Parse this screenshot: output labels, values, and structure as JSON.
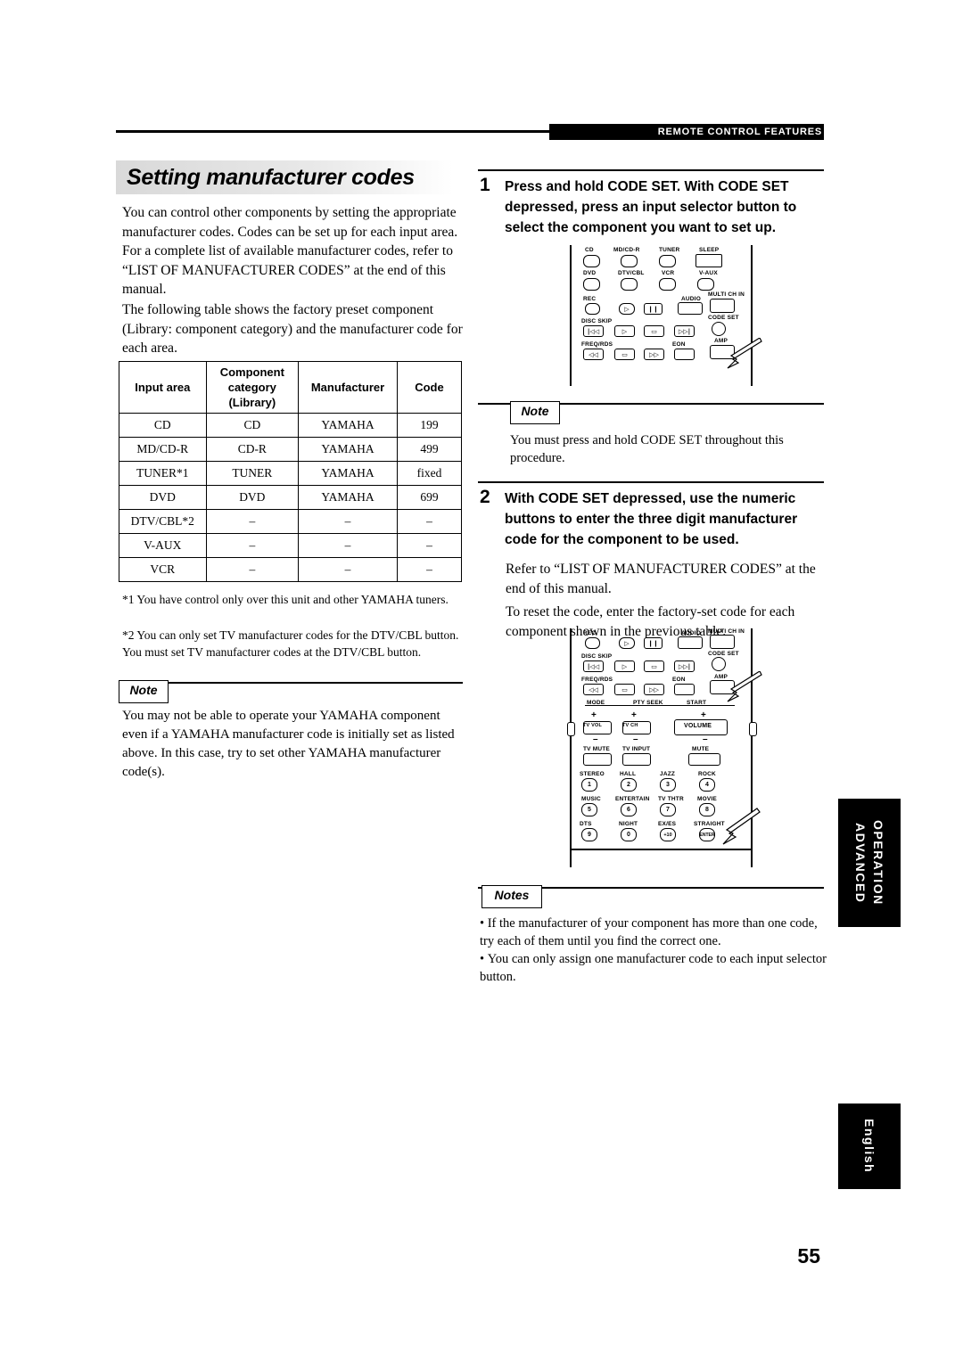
{
  "header": {
    "running_title": "REMOTE CONTROL FEATURES"
  },
  "page_number": "55",
  "left": {
    "title": "Setting manufacturer codes",
    "para1": "You can control other components by setting the appropriate manufacturer codes. Codes can be set up for each input area. For a complete list of available manufacturer codes, refer to “LIST OF MANUFACTURER CODES” at the end of this manual.",
    "para2": "The following table shows the factory preset component (Library: component category) and the manufacturer code for each area.",
    "table": {
      "headers": [
        "Input area",
        "Component category (Library)",
        "Manufacturer",
        "Code"
      ],
      "header_lines": {
        "h1": "Input area",
        "h2a": "Component",
        "h2b": "category",
        "h2c": "(Library)",
        "h3": "Manufacturer",
        "h4": "Code"
      },
      "rows": [
        [
          "CD",
          "CD",
          "YAMAHA",
          "199"
        ],
        [
          "MD/CD-R",
          "CD-R",
          "YAMAHA",
          "499"
        ],
        [
          "TUNER*1",
          "TUNER",
          "YAMAHA",
          "fixed"
        ],
        [
          "DVD",
          "DVD",
          "YAMAHA",
          "699"
        ],
        [
          "DTV/CBL*2",
          "–",
          "–",
          "–"
        ],
        [
          "V-AUX",
          "–",
          "–",
          "–"
        ],
        [
          "VCR",
          "–",
          "–",
          "–"
        ]
      ]
    },
    "footnote1": "*1 You have control only over this unit and other YAMAHA tuners.",
    "footnote2": "*2 You can only set TV manufacturer codes for the DTV/CBL button. You must set TV manufacturer codes at the DTV/CBL button.",
    "note_label": "Note",
    "note_text": "You may not be able to operate your YAMAHA component even if a YAMAHA manufacturer code is initially set as listed above. In this case, try to set other YAMAHA manufacturer code(s)."
  },
  "right": {
    "step1": {
      "number": "1",
      "heading": "Press and hold CODE SET. With CODE SET depressed, press an input selector button to select the component you want to set up.",
      "note_label": "Note",
      "note_text": "You must press and hold CODE SET throughout this procedure."
    },
    "step2": {
      "number": "2",
      "heading": "With CODE SET depressed, use the numeric buttons to enter the three digit manufacturer code for the component to be used.",
      "para1": "Refer to “LIST OF MANUFACTURER CODES” at the end of this manual.",
      "para2": "To reset the code, enter the factory-set code for each component shown in the previous table."
    },
    "notes_label": "Notes",
    "notes": [
      "If the manufacturer of your component has more than one code, try each of them until you find the correct one.",
      "You can only assign one manufacturer code to each input selector button."
    ]
  },
  "side_tabs": {
    "advanced_operation": "ADVANCED\nOPERATION",
    "advanced_line1": "ADVANCED",
    "advanced_line2": "OPERATION",
    "language": "English"
  },
  "remote_top": {
    "row1": [
      "CD",
      "MD/CD-R",
      "TUNER",
      "SLEEP"
    ],
    "row2": [
      "DVD",
      "DTV/CBL",
      "VCR",
      "V-AUX"
    ],
    "row3_labels": [
      "REC",
      "",
      "",
      "AUDIO",
      "MULTI CH IN"
    ],
    "row4_labels": [
      "DISC SKIP",
      "",
      "",
      "",
      "CODE SET"
    ],
    "row5_labels": [
      "FREQ/RDS",
      "",
      "EON",
      "",
      "AMP"
    ]
  },
  "remote_bottom": {
    "labels_top": [
      "REC",
      "AUDIO",
      "MULTI CH IN",
      "DISC SKIP",
      "CODE SET",
      "FREQ/RDS",
      "EON",
      "AMP"
    ],
    "mode_row": [
      "MODE",
      "PTY SEEK",
      "START"
    ],
    "vol_row": [
      "TV VOL",
      "TV CH",
      "VOLUME"
    ],
    "mute_row": [
      "TV MUTE",
      "TV INPUT",
      "MUTE"
    ],
    "preset_labels": [
      "STEREO",
      "HALL",
      "JAZZ",
      "ROCK",
      "MUSIC",
      "ENTERTAIN",
      "TV THTR",
      "MOVIE",
      "DTS",
      "NIGHT",
      "EX/ES",
      "STRAIGHT"
    ],
    "numeric": [
      "1",
      "2",
      "3",
      "4",
      "5",
      "6",
      "7",
      "8",
      "9",
      "0",
      "+10",
      "ENTER"
    ],
    "dts_label": "/DTS"
  }
}
